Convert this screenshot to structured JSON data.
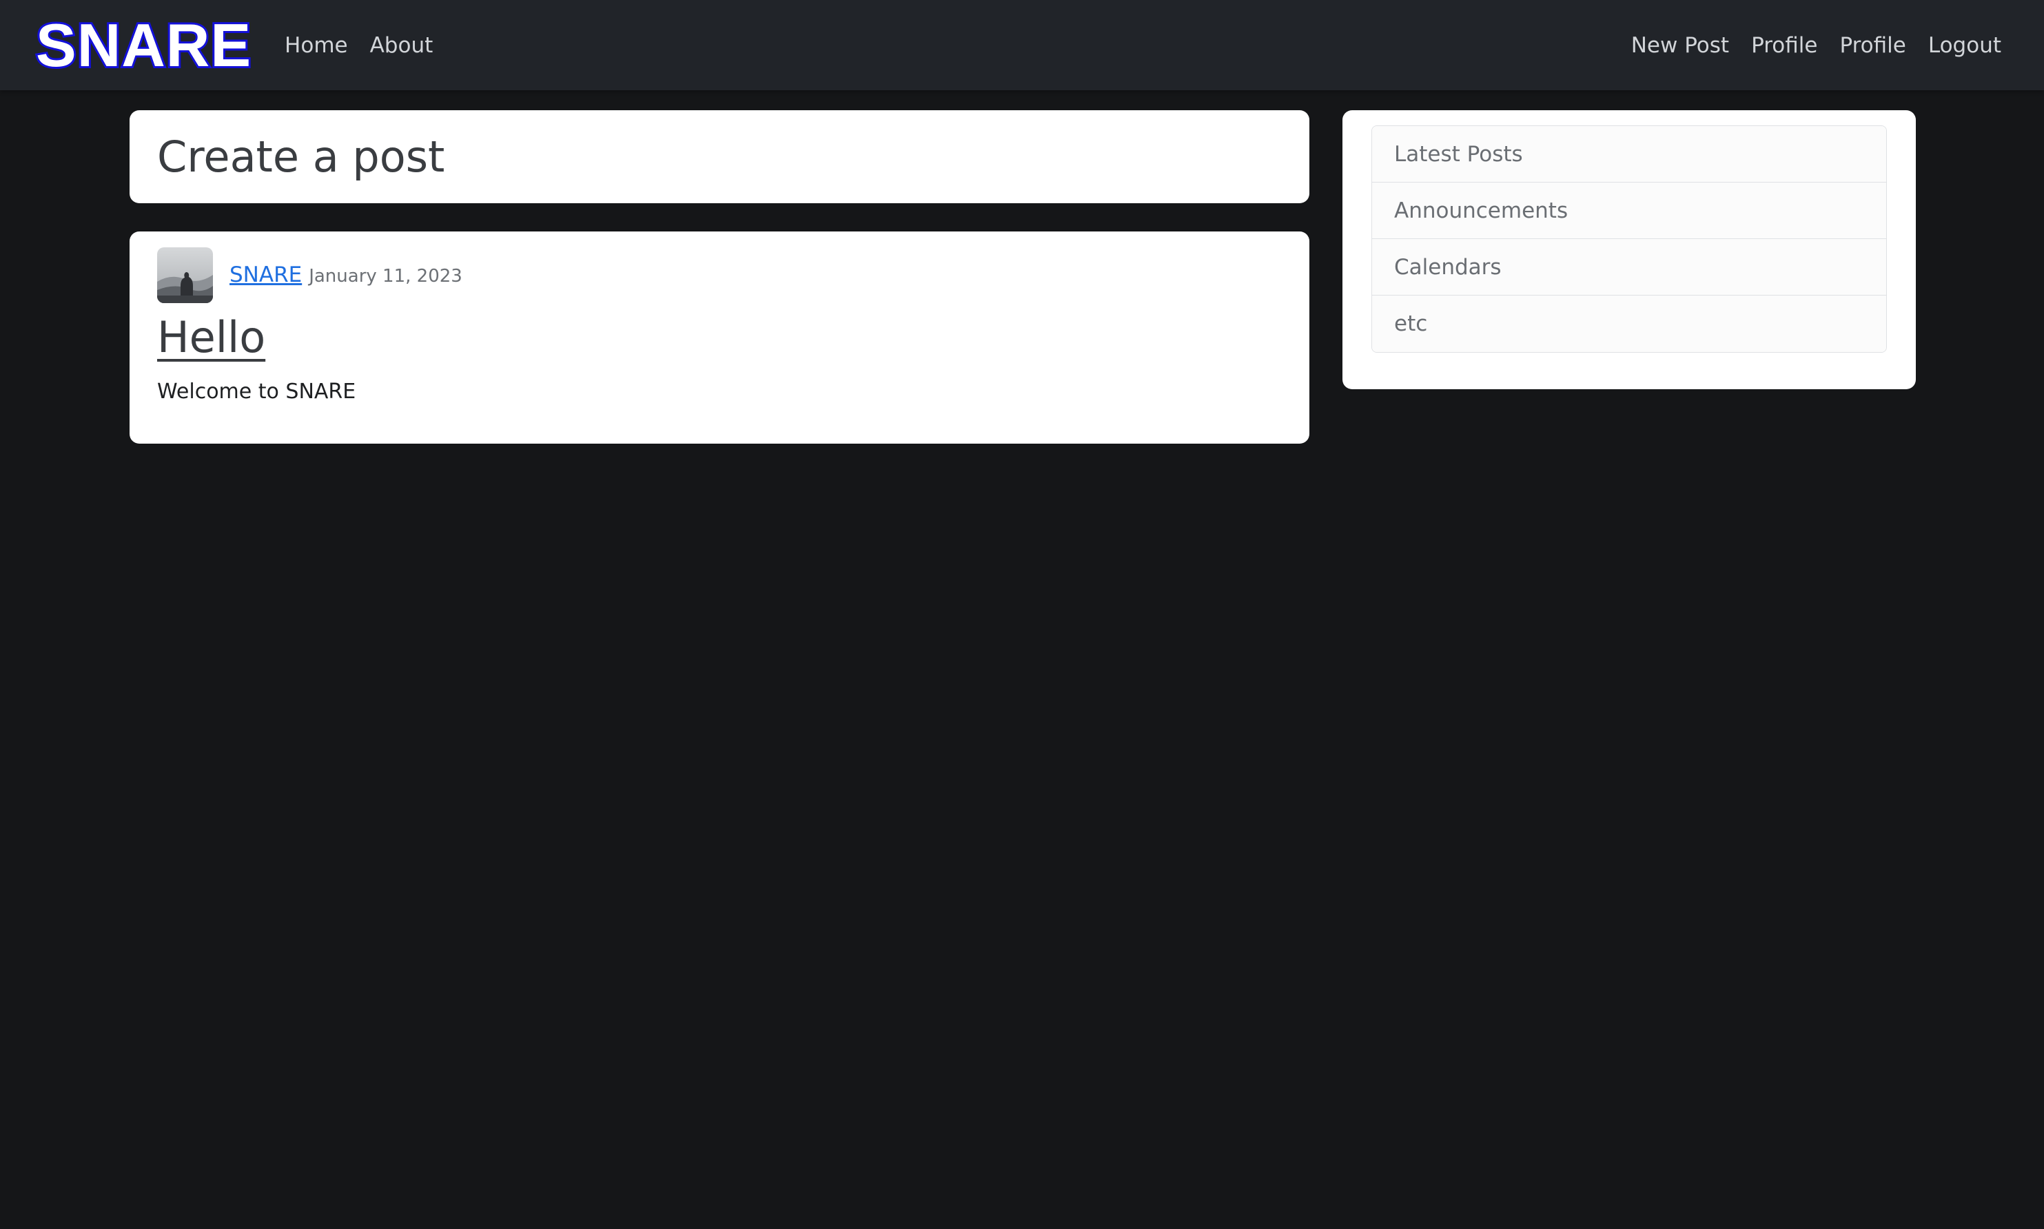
{
  "navbar": {
    "brand": "SNARE",
    "left_links": [
      "Home",
      "About"
    ],
    "right_links": [
      "New Post",
      "Profile",
      "Profile",
      "Logout"
    ]
  },
  "create_post": {
    "title": "Create a post"
  },
  "post": {
    "author": "SNARE",
    "date": "January 11, 2023",
    "title": "Hello",
    "body": "Welcome to SNARE",
    "avatar_icon": "mountain-silhouette-avatar"
  },
  "sidebar": {
    "items": [
      "Latest Posts",
      "Announcements",
      "Calendars",
      "etc"
    ]
  },
  "colors": {
    "background": "#151618",
    "navbar": "#212429",
    "brand_outline": "#1411d9",
    "link": "#1f6fe0"
  }
}
